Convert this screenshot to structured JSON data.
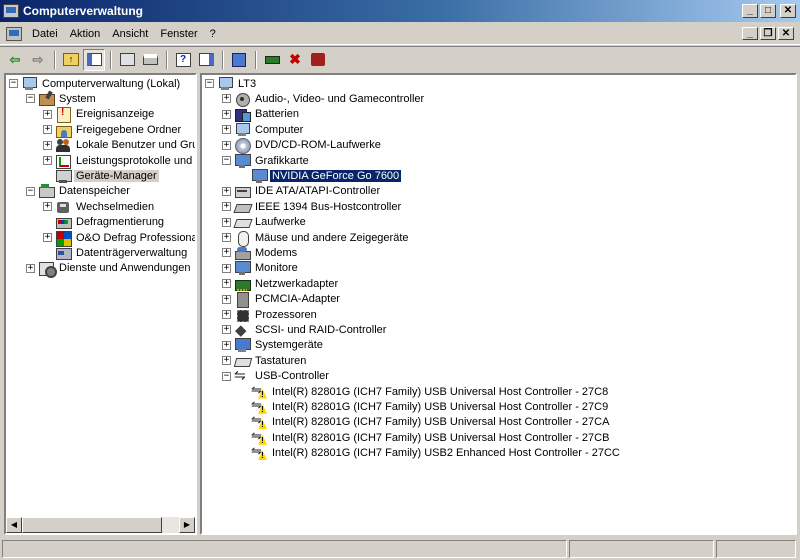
{
  "window": {
    "title": "Computerverwaltung"
  },
  "menu": [
    "Datei",
    "Aktion",
    "Ansicht",
    "Fenster",
    "?"
  ],
  "left_tree": [
    {
      "label": "Computerverwaltung (Lokal)",
      "icon": "computer-icon",
      "level": 0,
      "expander": "minus"
    },
    {
      "label": "System",
      "icon": "tools-icon",
      "level": 1,
      "expander": "minus"
    },
    {
      "label": "Ereignisanzeige",
      "icon": "event-viewer-icon",
      "level": 2,
      "expander": "plus"
    },
    {
      "label": "Freigegebene Ordner",
      "icon": "shared-folder-icon",
      "level": 2,
      "expander": "plus"
    },
    {
      "label": "Lokale Benutzer und Gruppe",
      "icon": "users-icon",
      "level": 2,
      "expander": "plus"
    },
    {
      "label": "Leistungsprotokolle und War",
      "icon": "performance-icon",
      "level": 2,
      "expander": "plus"
    },
    {
      "label": "Geräte-Manager",
      "icon": "device-manager-icon",
      "level": 2,
      "expander": "none",
      "selected": true
    },
    {
      "label": "Datenspeicher",
      "icon": "storage-icon",
      "level": 1,
      "expander": "minus"
    },
    {
      "label": "Wechselmedien",
      "icon": "removable-media-icon",
      "level": 2,
      "expander": "plus"
    },
    {
      "label": "Defragmentierung",
      "icon": "defrag-icon",
      "level": 2,
      "expander": "none"
    },
    {
      "label": "O&O Defrag Professional Ed",
      "icon": "oo-defrag-icon",
      "level": 2,
      "expander": "plus"
    },
    {
      "label": "Datenträgerverwaltung",
      "icon": "disk-management-icon",
      "level": 2,
      "expander": "none"
    },
    {
      "label": "Dienste und Anwendungen",
      "icon": "services-icon",
      "level": 1,
      "expander": "plus"
    }
  ],
  "right_tree": [
    {
      "label": "LT3",
      "icon": "computer-icon",
      "level": 0,
      "expander": "minus"
    },
    {
      "label": "Audio-, Video- und Gamecontroller",
      "icon": "audio-icon",
      "level": 1,
      "expander": "plus"
    },
    {
      "label": "Batterien",
      "icon": "battery-icon",
      "level": 1,
      "expander": "plus"
    },
    {
      "label": "Computer",
      "icon": "computer-icon",
      "level": 1,
      "expander": "plus"
    },
    {
      "label": "DVD/CD-ROM-Laufwerke",
      "icon": "dvd-icon",
      "level": 1,
      "expander": "plus"
    },
    {
      "label": "Grafikkarte",
      "icon": "display-adapter-icon",
      "level": 1,
      "expander": "minus"
    },
    {
      "label": "NVIDIA GeForce Go 7600",
      "icon": "display-adapter-icon",
      "level": 2,
      "expander": "none",
      "selected": true
    },
    {
      "label": "IDE ATA/ATAPI-Controller",
      "icon": "ide-icon",
      "level": 1,
      "expander": "plus"
    },
    {
      "label": "IEEE 1394 Bus-Hostcontroller",
      "icon": "ieee1394-icon",
      "level": 1,
      "expander": "plus"
    },
    {
      "label": "Laufwerke",
      "icon": "drive-icon",
      "level": 1,
      "expander": "plus"
    },
    {
      "label": "Mäuse und andere Zeigegeräte",
      "icon": "mouse-icon",
      "level": 1,
      "expander": "plus"
    },
    {
      "label": "Modems",
      "icon": "modem-icon",
      "level": 1,
      "expander": "plus"
    },
    {
      "label": "Monitore",
      "icon": "monitor-icon",
      "level": 1,
      "expander": "plus"
    },
    {
      "label": "Netzwerkadapter",
      "icon": "network-adapter-icon",
      "level": 1,
      "expander": "plus"
    },
    {
      "label": "PCMCIA-Adapter",
      "icon": "pcmcia-icon",
      "level": 1,
      "expander": "plus"
    },
    {
      "label": "Prozessoren",
      "icon": "processor-icon",
      "level": 1,
      "expander": "plus"
    },
    {
      "label": "SCSI- und RAID-Controller",
      "icon": "scsi-icon",
      "level": 1,
      "expander": "plus"
    },
    {
      "label": "Systemgeräte",
      "icon": "system-devices-icon",
      "level": 1,
      "expander": "plus"
    },
    {
      "label": "Tastaturen",
      "icon": "keyboard-icon",
      "level": 1,
      "expander": "plus"
    },
    {
      "label": "USB-Controller",
      "icon": "usb-icon",
      "level": 1,
      "expander": "minus"
    },
    {
      "label": "Intel(R) 82801G (ICH7 Family) USB Universal Host Controller - 27C8",
      "icon": "usb-warning-icon",
      "level": 2,
      "expander": "none"
    },
    {
      "label": "Intel(R) 82801G (ICH7 Family) USB Universal Host Controller - 27C9",
      "icon": "usb-warning-icon",
      "level": 2,
      "expander": "none"
    },
    {
      "label": "Intel(R) 82801G (ICH7 Family) USB Universal Host Controller - 27CA",
      "icon": "usb-warning-icon",
      "level": 2,
      "expander": "none"
    },
    {
      "label": "Intel(R) 82801G (ICH7 Family) USB Universal Host Controller - 27CB",
      "icon": "usb-warning-icon",
      "level": 2,
      "expander": "none"
    },
    {
      "label": "Intel(R) 82801G (ICH7 Family) USB2 Enhanced Host Controller - 27CC",
      "icon": "usb-warning-icon",
      "level": 2,
      "expander": "none"
    }
  ],
  "toolbar": [
    "back-icon",
    "forward-icon",
    "up-icon",
    "show-hide-tree-icon",
    "properties-icon",
    "print-icon",
    "help-icon",
    "view-icon",
    "scan-hardware-icon",
    "update-driver-icon",
    "uninstall-icon",
    "disable-icon"
  ],
  "colors": {
    "title_start": "#0a246a",
    "title_end": "#a6caf0",
    "selection": "#0a246a",
    "face": "#d4d0c8"
  }
}
